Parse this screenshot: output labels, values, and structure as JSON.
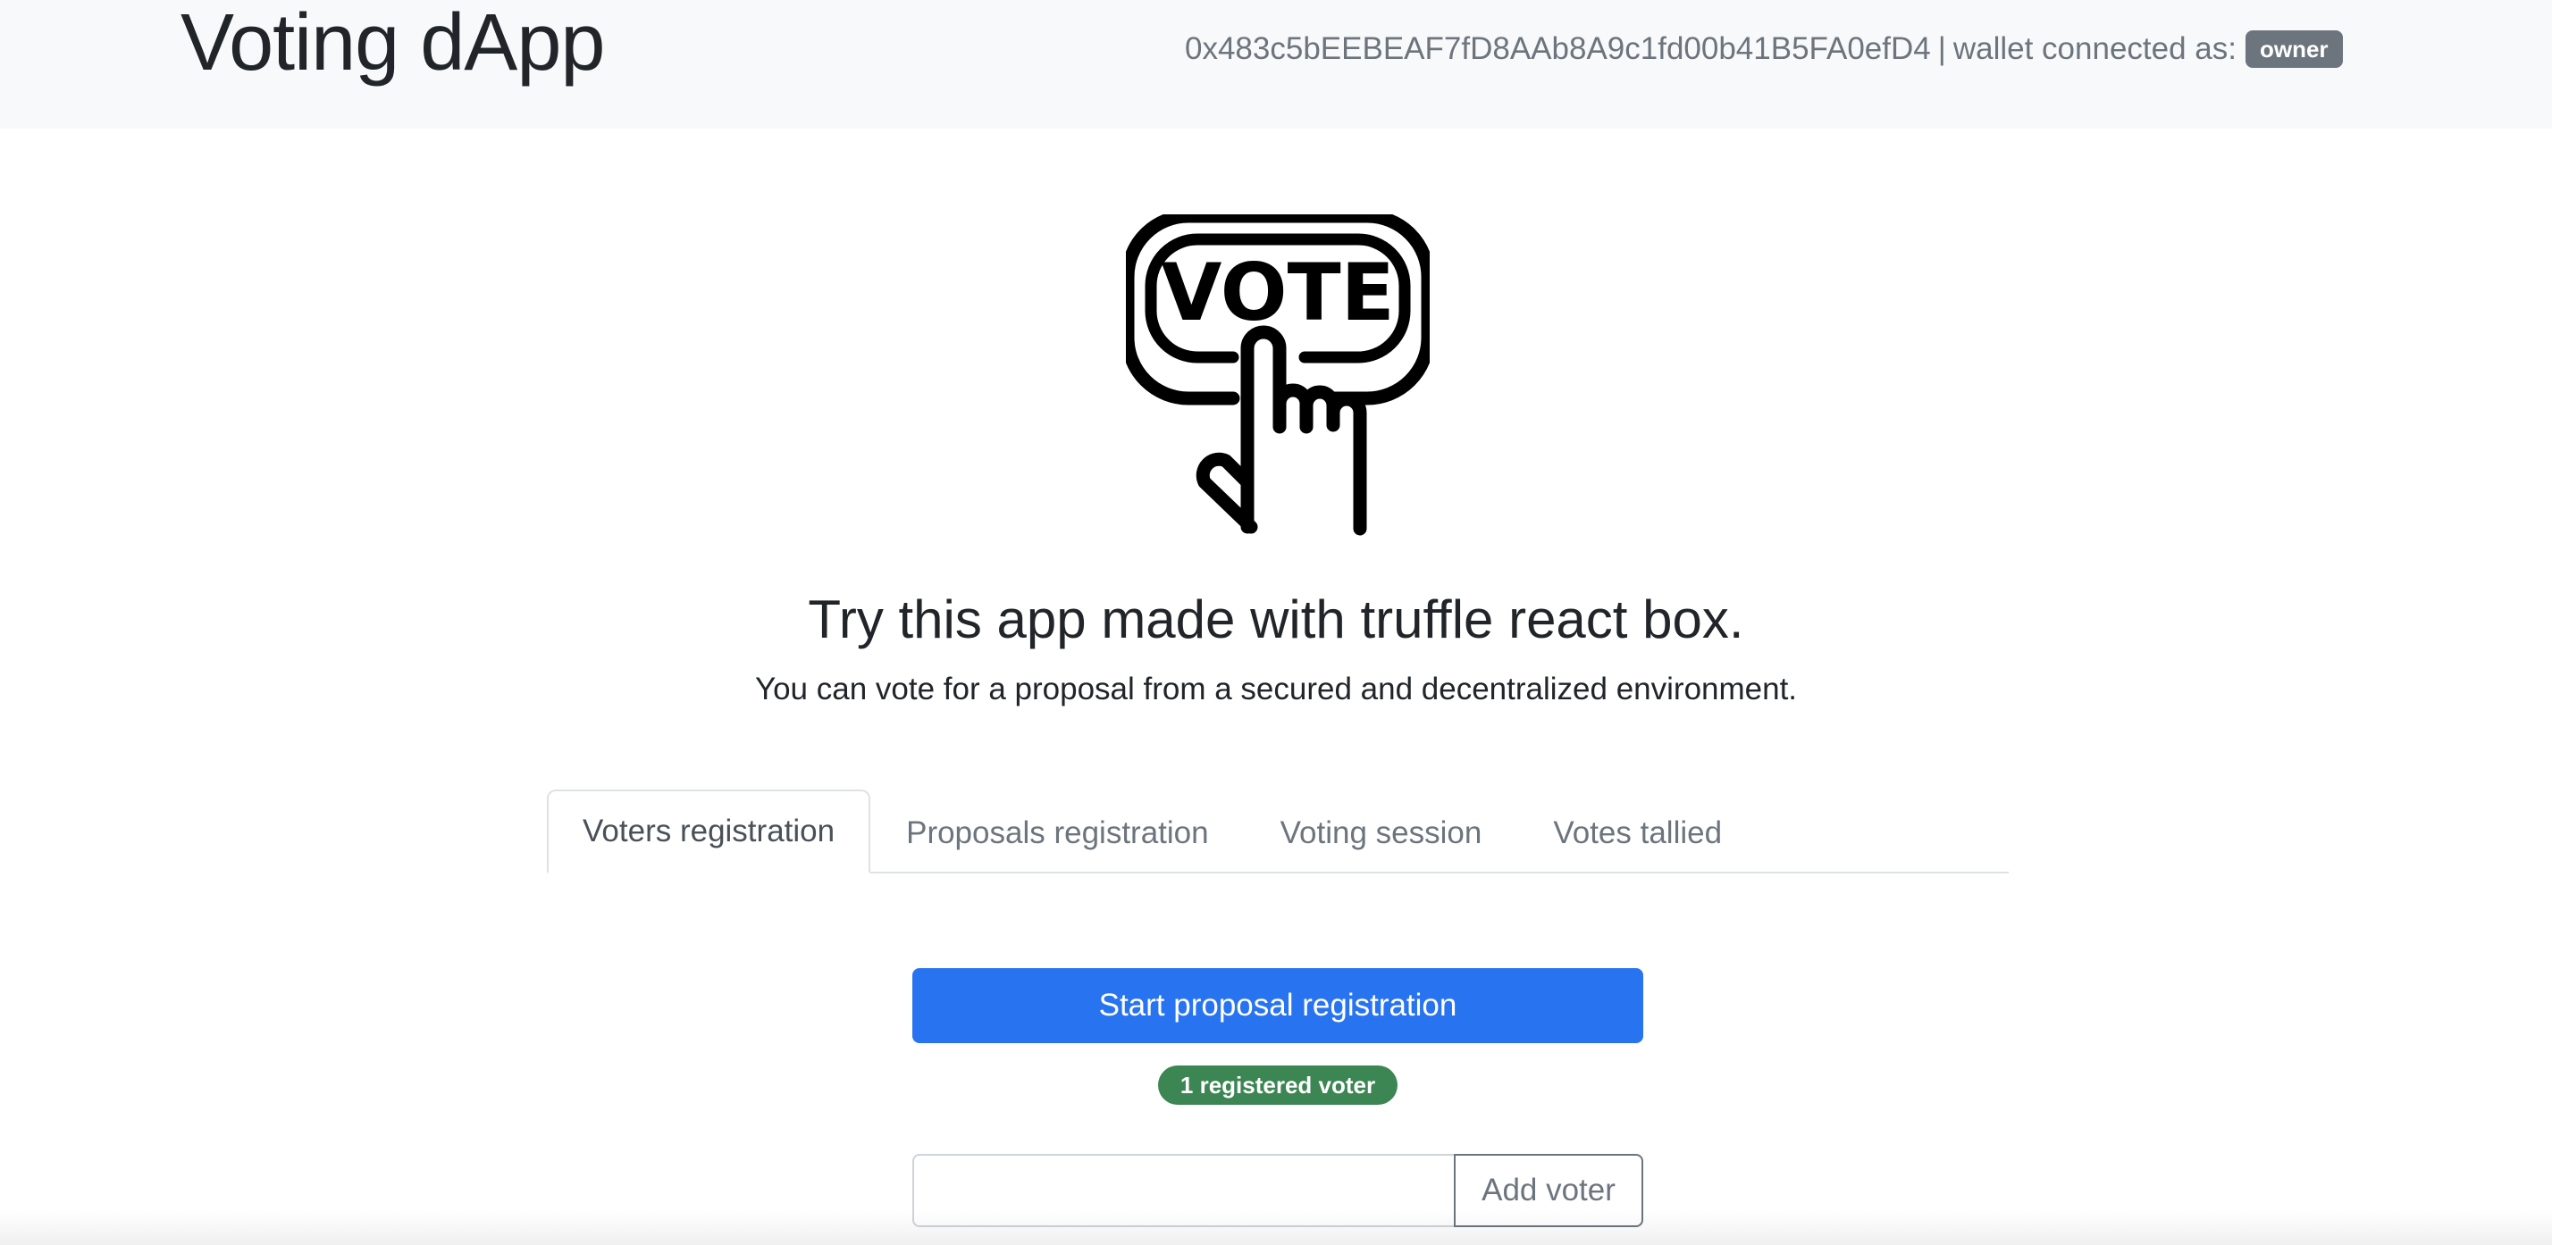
{
  "header": {
    "title": "Voting dApp",
    "wallet_address": "0x483c5bEEBEAF7fD8AAb8A9c1fd00b41B5FA0efD4",
    "separator": "|",
    "wallet_label": "wallet connected as:",
    "role": "owner"
  },
  "hero": {
    "logo_icon": "vote-button-hand-icon",
    "logo_text": "VOTE",
    "title": "Try this app made with truffle react box.",
    "subtitle": "You can vote for a proposal from a secured and decentralized environment."
  },
  "tabs": [
    {
      "label": "Voters registration",
      "active": true
    },
    {
      "label": "Proposals registration",
      "active": false
    },
    {
      "label": "Voting session",
      "active": false
    },
    {
      "label": "Votes tallied",
      "active": false
    }
  ],
  "main": {
    "primary_button": "Start proposal registration",
    "voter_count_badge": "1 registered voter",
    "voter_input_value": "",
    "voter_input_placeholder": "",
    "add_voter_button": "Add voter"
  },
  "colors": {
    "header_bg": "#f8f9fa",
    "primary": "#2874f0",
    "success_badge": "#3c8653",
    "secondary": "#6c757d"
  }
}
